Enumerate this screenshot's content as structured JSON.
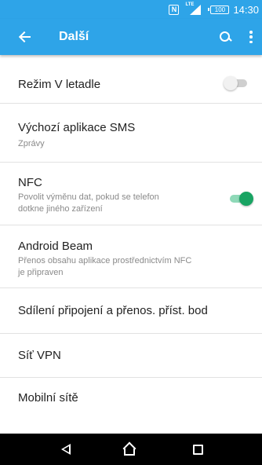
{
  "status_bar": {
    "nfc_label": "N",
    "network_label": "LTE",
    "battery_level": "100",
    "time": "14:30"
  },
  "app_bar": {
    "title": "Další",
    "icons": [
      "back-arrow-icon",
      "search-icon",
      "overflow-menu-icon"
    ]
  },
  "settings": [
    {
      "label": "Režim V letadle",
      "subtitle": "",
      "toggle": "off"
    },
    {
      "label": "Výchozí aplikace SMS",
      "subtitle": "Zprávy"
    },
    {
      "label": "NFC",
      "subtitle_line1": "Povolit výměnu dat, pokud se telefon",
      "subtitle_line2": "dotkne jiného zařízení",
      "toggle": "on"
    },
    {
      "label": "Android Beam",
      "subtitle_line1": "Přenos obsahu aplikace prostřednictvím NFC",
      "subtitle_line2": "je připraven"
    },
    {
      "label": "Sdílení připojení a přenos. příst. bod"
    },
    {
      "label": "Síť VPN"
    },
    {
      "label": "Mobilní sítě"
    }
  ],
  "nav_bar": {
    "icons": [
      "nav-back-icon",
      "nav-home-icon",
      "nav-recents-icon"
    ]
  },
  "colors": {
    "primary": "#2ea4e8",
    "toggle_on": "#19a463",
    "toggle_off": "#cfcfcf"
  }
}
